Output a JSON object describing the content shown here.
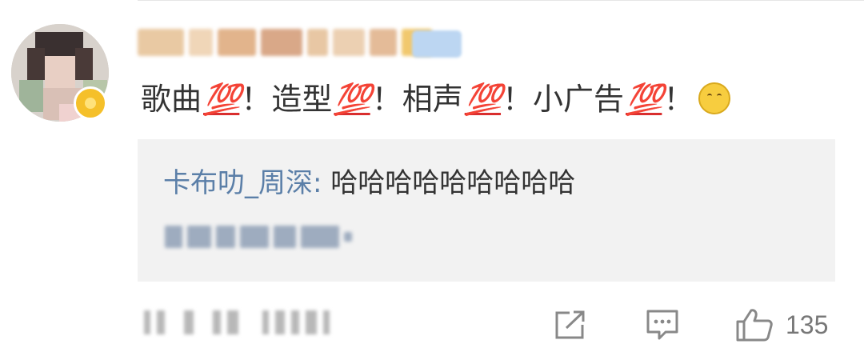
{
  "comment": {
    "text_parts": [
      "歌曲",
      "💯",
      "！造型",
      "💯",
      "！相声",
      "💯",
      "！小广告",
      "💯",
      "！"
    ],
    "emoji_icon": "thinking-face-icon"
  },
  "reply": {
    "author": "卡布叻_周深",
    "colon": ":",
    "text": "哈哈哈哈哈哈哈哈哈"
  },
  "actions": {
    "share_icon": "share-icon",
    "comment_icon": "comment-icon",
    "like_icon": "thumbs-up-icon",
    "like_count": "135"
  },
  "colors": {
    "link_blue": "#5b7fa8",
    "text": "#333333",
    "reply_bg": "#f2f2f2",
    "hundred_red": "#d92e2e"
  }
}
